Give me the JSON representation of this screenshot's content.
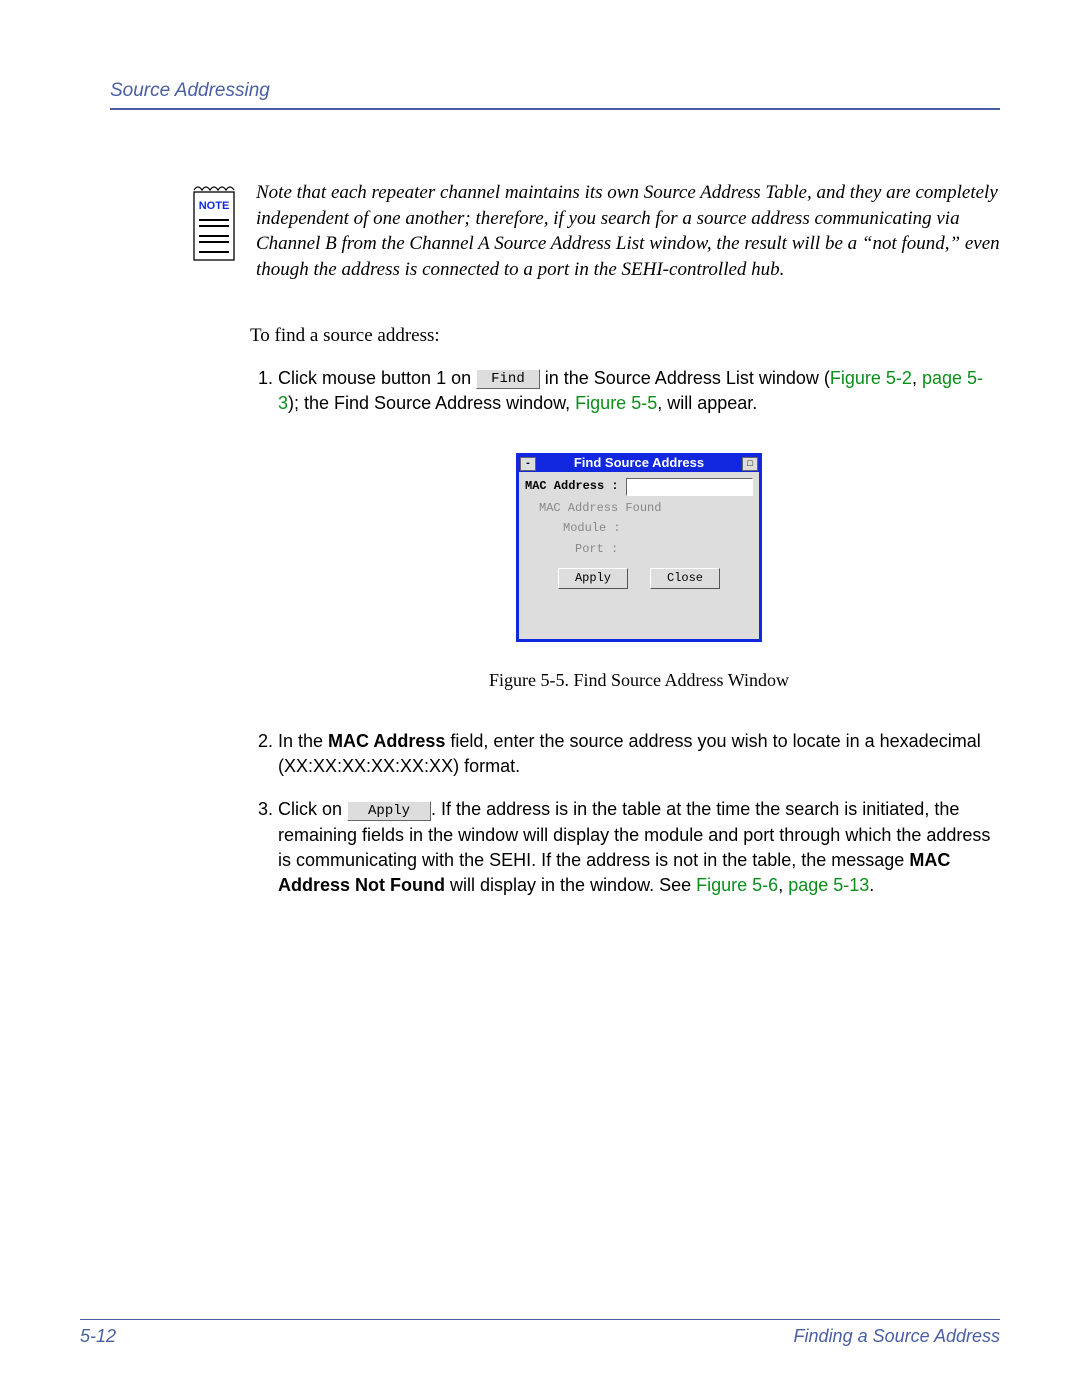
{
  "header": {
    "section_title": "Source Addressing"
  },
  "note": {
    "label": "NOTE",
    "text": "Note that each repeater channel maintains its own Source Address Table, and they are completely independent of one another; therefore, if you search for a source address communicating via Channel B from the Channel A Source Address List window, the result will be a “not found,” even though the address is connected to a port in the SEHI-controlled hub."
  },
  "intro": "To find a source address:",
  "steps": {
    "s1": {
      "pre": "Click mouse button 1 on ",
      "button": "Find",
      "post": " in the Source Address List window (",
      "xref1": "Figure 5-2",
      "sep1": ", ",
      "xref2": "page 5-3",
      "post2": "); the Find Source Address window, ",
      "xref3": "Figure 5-5",
      "post3": ", will appear."
    },
    "s2": {
      "pre": "In the ",
      "bold": "MAC Address",
      "post": " field, enter the source address you wish to locate in a hexadecimal (XX:XX:XX:XX:XX:XX) format."
    },
    "s3": {
      "pre": "Click on ",
      "button": "Apply",
      "post1": ". If the address is in the table at the time the search is initiated, the remaining fields in the window will display the module and port through which the address is communicating with the SEHI. If the address is not in the table, the message ",
      "bold": "MAC Address Not Found",
      "post2": " will display in the window. See ",
      "xref1": "Figure 5-6",
      "sep": ", ",
      "xref2": "page 5-13",
      "post3": "."
    }
  },
  "figure": {
    "title": "Find Source Address",
    "mac_label": "MAC Address : ",
    "found_label": "MAC Address Found",
    "module_label": "Module :",
    "port_label": "Port :",
    "apply": "Apply",
    "close": "Close",
    "caption": "Figure 5-5. Find Source Address Window"
  },
  "footer": {
    "page_num": "5-12",
    "topic": "Finding a Source Address"
  }
}
